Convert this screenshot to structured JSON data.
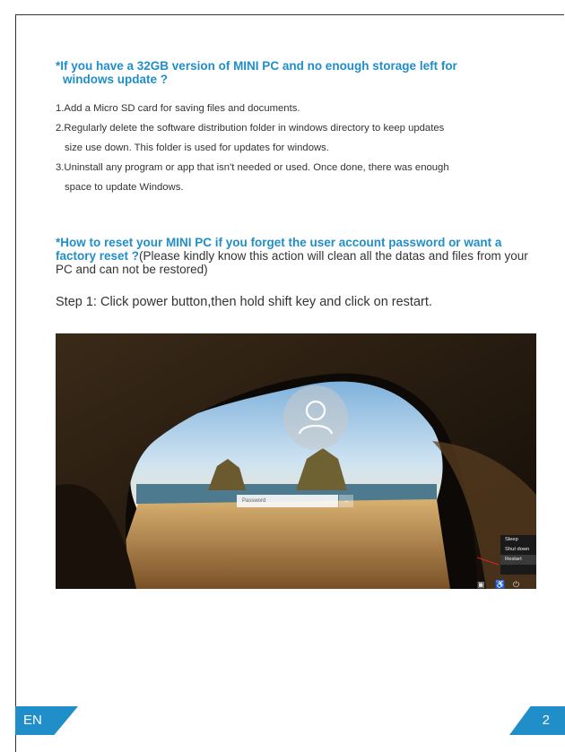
{
  "section1": {
    "heading_line1": "*If you have a 32GB version of MINI PC and no enough storage left for",
    "heading_line2": "windows update ?",
    "items": [
      {
        "line1": "1.Add a Micro SD card for saving files and documents.",
        "line2": ""
      },
      {
        "line1": "2.Regularly delete the software distribution folder in windows directory to keep updates",
        "line2": "size  use down. This folder is used for updates for windows."
      },
      {
        "line1": "3.Uninstall any program or app that isn't needed or used. Once done, there was enough",
        "line2": "space  to update Windows."
      }
    ]
  },
  "section2": {
    "heading_blue": "*How to reset your MINI PC if you forget the user account password or want a factory reset ?",
    "heading_note": "(Please kindly know this action will clean all the datas and files from your PC and can not be restored)",
    "step1": "Step 1: Click power button,then hold shift key and click on restart."
  },
  "screenshot": {
    "password_placeholder": "Password",
    "submit_glyph": "→",
    "power_menu": [
      "Sleep",
      "Shut down",
      "Restart"
    ],
    "selected_option": "Restart"
  },
  "footer": {
    "language": "EN",
    "page_number": "2"
  },
  "colors": {
    "accent": "#1f8ec9"
  }
}
